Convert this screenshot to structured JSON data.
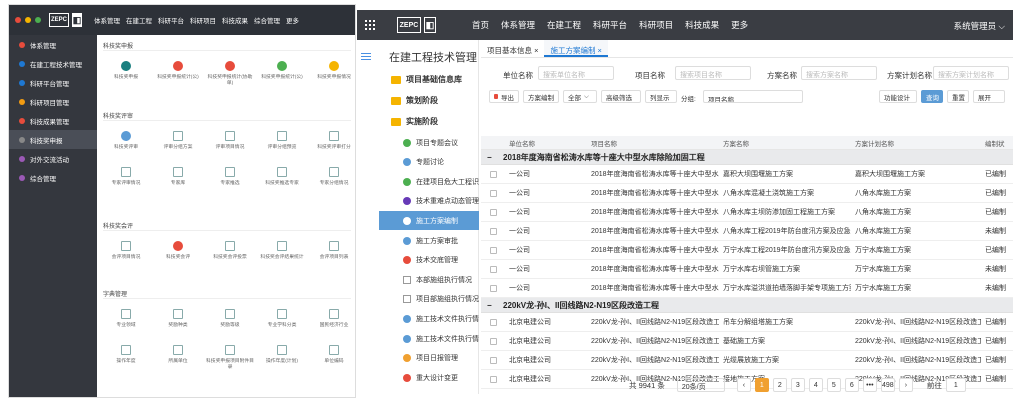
{
  "left_window": {
    "logo_text": "ZEPC",
    "topnav": [
      "体系管理",
      "在建工程",
      "科研平台",
      "科研项目",
      "科技成果",
      "综合管理",
      "更多"
    ],
    "sidebar": [
      {
        "label": "体系管理",
        "color": "#e74c3c"
      },
      {
        "label": "在建工程技术管理",
        "color": "#1e78d3"
      },
      {
        "label": "科研平台管理",
        "color": "#1e78d3"
      },
      {
        "label": "科研项目管理",
        "color": "#f39c12"
      },
      {
        "label": "科技成果管理",
        "color": "#e74c3c"
      },
      {
        "label": "科技奖申报",
        "color": "#888"
      },
      {
        "label": "对外交流活动",
        "color": "#9b59b6"
      },
      {
        "label": "综合管理",
        "color": "#9b59b6"
      }
    ],
    "sections": [
      {
        "title": "科技奖申报",
        "items": [
          "科技奖申报",
          "科技奖申报统计(公)",
          "科技奖申报统计(协助单)",
          "科技奖申报统计(公)",
          "科技奖申报情况"
        ]
      },
      {
        "title": "科技奖评审",
        "items": [
          "科技奖评审",
          "评审分组方案",
          "评审项目情况",
          "评审分组预览",
          "科技奖评审打分",
          "专家评审情况",
          "专家库",
          "专家推选",
          "科技奖推选专家",
          "专家分组情况"
        ]
      },
      {
        "title": "科技奖会评",
        "items": [
          "会评项目情况",
          "科技奖会评",
          "科技奖会评投票",
          "科技奖会评结果统计",
          "会评项目列表"
        ]
      },
      {
        "title": "字典管理",
        "items": [
          "专业领域",
          "奖励种类",
          "奖励等级",
          "专业学科分类",
          "国民经济行业",
          "操作年度",
          "所属单位",
          "科技奖申报项目附件目录",
          "操作年度(计划)",
          "单位编码"
        ]
      }
    ]
  },
  "right_window": {
    "logo_text": "ZEPC",
    "topnav": [
      "首页",
      "体系管理",
      "在建工程",
      "科研平台",
      "科研项目",
      "科技成果",
      "更多"
    ],
    "user": "系统管理员",
    "sidebar_title": "在建工程技术管理",
    "tree": [
      {
        "type": "folder",
        "label": "项目基础信息库"
      },
      {
        "type": "folder",
        "label": "策划阶段"
      },
      {
        "type": "folder",
        "label": "实施阶段"
      },
      {
        "type": "sub",
        "label": "项目专题会议",
        "color": "#4caf50"
      },
      {
        "type": "sub",
        "label": "专题讨论",
        "color": "#5b9bd5"
      },
      {
        "type": "sub",
        "label": "在建项目危大工程识别",
        "color": "#4caf50"
      },
      {
        "type": "sub",
        "label": "技术重难点动态管理",
        "color": "#673ab7"
      },
      {
        "type": "sub",
        "label": "施工方案编制",
        "color": "#f0a030",
        "active": true
      },
      {
        "type": "sub",
        "label": "施工方案审批",
        "color": "#5b9bd5"
      },
      {
        "type": "sub",
        "label": "技术交底管理",
        "color": "#e74c3c"
      },
      {
        "type": "sub",
        "label": "本部施组执行情况",
        "square": true
      },
      {
        "type": "sub",
        "label": "项目部施组执行情况",
        "square": true
      },
      {
        "type": "sub",
        "label": "施工技术文件执行情...",
        "color": "#5b9bd5"
      },
      {
        "type": "sub",
        "label": "施工技术文件执行情...",
        "color": "#5b9bd5"
      },
      {
        "type": "sub",
        "label": "项目日报管理",
        "color": "#f0a030"
      },
      {
        "type": "sub",
        "label": "重大设计变更",
        "color": "#e74c3c"
      }
    ],
    "tabs": [
      "项目基本信息",
      "施工方案编制"
    ],
    "filters": [
      {
        "label": "单位名称",
        "placeholder": "搜索单位名称"
      },
      {
        "label": "项目名称",
        "placeholder": "搜索项目名称"
      },
      {
        "label": "方案名称",
        "placeholder": "搜索方案名称"
      },
      {
        "label": "方案计划名称",
        "placeholder": "搜索方案计划名称"
      }
    ],
    "toolbar": {
      "export": "导出",
      "scheme": "方案编制",
      "all": "全部",
      "advanced": "高级筛选",
      "columns": "列显示",
      "group_label": "分组:",
      "group_value": "项目名称",
      "function_design": "功能设计",
      "query": "查询",
      "reset": "重置",
      "expand": "展开"
    },
    "columns": [
      "单位名称",
      "项目名称",
      "方案名称",
      "方案计划名称",
      "编制状"
    ],
    "groups": [
      {
        "title": "2018年度海南省松涛水库等十座大中型水库除险加固工程",
        "rows": [
          [
            "一公司",
            "2018年度海南省松涛水库等十座大中型水库除",
            "嘉积大坝围堰施工方案",
            "嘉积大坝围堰施工方案",
            "已编制"
          ],
          [
            "一公司",
            "2018年度海南省松涛水库等十座大中型水库除",
            "八角水库混凝土浇筑施工方案",
            "八角水库施工方案",
            "已编制"
          ],
          [
            "一公司",
            "2018年度海南省松涛水库等十座大中型水库除",
            "八角水库主坝防渗加固工程施工方案",
            "八角水库施工方案",
            "已编制"
          ],
          [
            "一公司",
            "2018年度海南省松涛水库等十座大中型水库除",
            "八角水库工程2019年防台度汛方案及应急预案",
            "八角水库施工方案",
            "未编制"
          ],
          [
            "一公司",
            "2018年度海南省松涛水库等十座大中型水库除",
            "万宁水库工程2019年防台度汛方案及应急预案",
            "万宁水库施工方案",
            "已编制"
          ],
          [
            "一公司",
            "2018年度海南省松涛水库等十座大中型水库除",
            "万宁水库右坝管施工方案",
            "万宁水库施工方案",
            "未编制"
          ],
          [
            "一公司",
            "2018年度海南省松涛水库等十座大中型水库除",
            "万宁水库溢洪道拍墙落脚手架专项施工方案",
            "万宁水库施工方案",
            "未编制"
          ]
        ]
      },
      {
        "title": "220kV龙-孙I、II回线路N2-N19区段改造工程",
        "rows": [
          [
            "北京电建公司",
            "220kV龙-孙I、II回线路N2-N19区段改造工",
            "吊车分解组塔施工方案",
            "220kV龙-孙I、II回线路N2-N19区段改造工程",
            "已编制"
          ],
          [
            "北京电建公司",
            "220kV龙-孙I、II回线路N2-N19区段改造工",
            "基础施工方案",
            "220kV龙-孙I、II回线路N2-N19区段改造工程",
            "已编制"
          ],
          [
            "北京电建公司",
            "220kV龙-孙I、II回线路N2-N19区段改造工",
            "光缆展放施工方案",
            "220kV龙-孙I、II回线路N2-N19区段改造工程",
            "已编制"
          ],
          [
            "北京电建公司",
            "220kV龙-孙I、II回线路N2-N19区段改造工",
            "接地施工方案",
            "220kV龙-孙I、II回线路N2-N19区段改造工程",
            "已编制"
          ],
          [
            "北京电建公司",
            "220kV龙-孙I、II回线路N2-N19区段改造工",
            "...",
            "220kV龙-孙I、II回线路N2-N19区段改造工程",
            "已编制"
          ]
        ]
      }
    ],
    "pager": {
      "total": "共 9941 条",
      "size": "20条/页",
      "pages": [
        "1",
        "2",
        "3",
        "4",
        "5",
        "6",
        "•••",
        "498"
      ],
      "current": "1",
      "goto": "前往",
      "goto_value": "1"
    }
  }
}
